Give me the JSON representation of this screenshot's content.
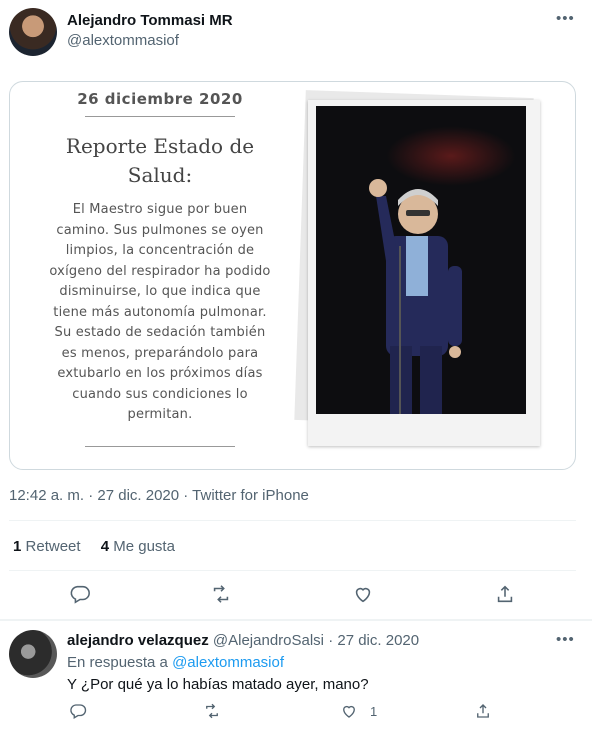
{
  "tweet": {
    "author_name": "Alejandro Tommasi MR",
    "author_handle": "@alextommasiof",
    "more_icon": "ellipsis-icon",
    "media": {
      "date": "26 diciembre 2020",
      "title_line1": "Reporte Estado de",
      "title_line2": "Salud:",
      "body_lines": [
        "El Maestro sigue por buen",
        "camino. Sus pulmones se oyen",
        "limpios, la concentración de",
        "oxígeno del respirador ha podido",
        "disminuirse, lo que indica que",
        "tiene más autonomía pulmonar.",
        "Su estado de sedación también",
        "es menos, preparándolo para",
        "extubarlo en los próximos días",
        "cuando sus condiciones lo",
        "permitan."
      ]
    },
    "meta": "12:42 a. m. · 27 dic. 2020 · Twitter for iPhone",
    "stats": {
      "retweets_count": "1",
      "retweets_label": "Retweet",
      "likes_count": "4",
      "likes_label": "Me gusta"
    },
    "actions": [
      "reply-icon",
      "retweet-icon",
      "like-icon",
      "share-icon"
    ]
  },
  "reply": {
    "author_name": "alejandro velazquez",
    "author_handle": "@AlejandroSalsi",
    "date": "27 dic. 2020",
    "separator": "·",
    "reply_prefix": "En respuesta a",
    "reply_to": "@alextommasiof",
    "text": "Y ¿Por qué ya lo habías matado ayer, mano?",
    "like_count": "1",
    "actions": [
      "reply-icon",
      "retweet-icon",
      "like-icon",
      "share-icon"
    ]
  },
  "colors": {
    "accent": "#1d9bf0",
    "secondary_text": "#536471",
    "primary_text": "#0f1419",
    "border": "#cfd9de"
  }
}
